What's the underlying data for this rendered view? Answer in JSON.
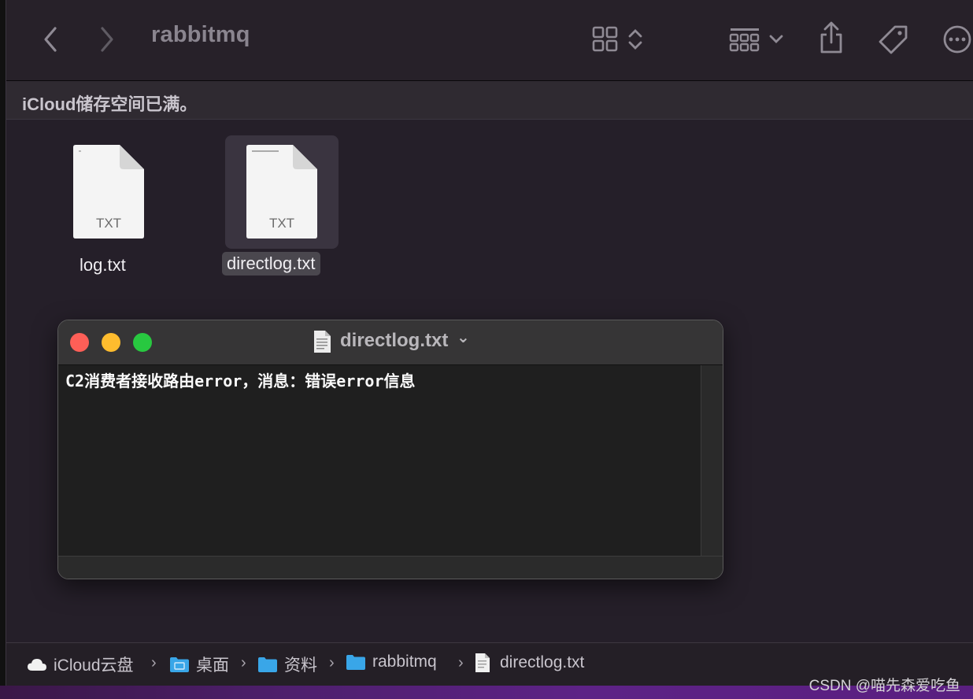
{
  "toolbar": {
    "title": "rabbitmq",
    "back_icon": "chevron-left-icon",
    "forward_icon": "chevron-right-icon",
    "view_icon": "icon-grid-icon",
    "group_icon": "group-by-icon",
    "share_icon": "share-icon",
    "tag_icon": "tag-icon",
    "more_icon": "ellipsis-circle-icon"
  },
  "banner": {
    "text": "iCloud储存空间已满。"
  },
  "files": [
    {
      "name": "log.txt",
      "type_label": "TXT",
      "selected": false
    },
    {
      "name": "directlog.txt",
      "type_label": "TXT",
      "selected": true
    }
  ],
  "preview_window": {
    "title": "directlog.txt",
    "title_chevron": "⌄",
    "content": "C2消费者接收路由error，消息：错误error信息",
    "traffic_lights": {
      "close": "#fe5f57",
      "minimize": "#febc2e",
      "zoom": "#28c840"
    }
  },
  "pathbar": {
    "items": [
      {
        "label": "iCloud云盘",
        "icon": "cloud-icon"
      },
      {
        "label": "桌面",
        "icon": "folder-icon"
      },
      {
        "label": "资料",
        "icon": "folder-icon"
      },
      {
        "label": "rabbitmq",
        "icon": "folder-icon"
      },
      {
        "label": "directlog.txt",
        "icon": "document-icon"
      }
    ],
    "separator": "›"
  },
  "watermark": "CSDN @喵先森爱吃鱼",
  "colors": {
    "background": "#251f29",
    "folder_blue": "#39a6e8",
    "selection": "#3a3440"
  }
}
